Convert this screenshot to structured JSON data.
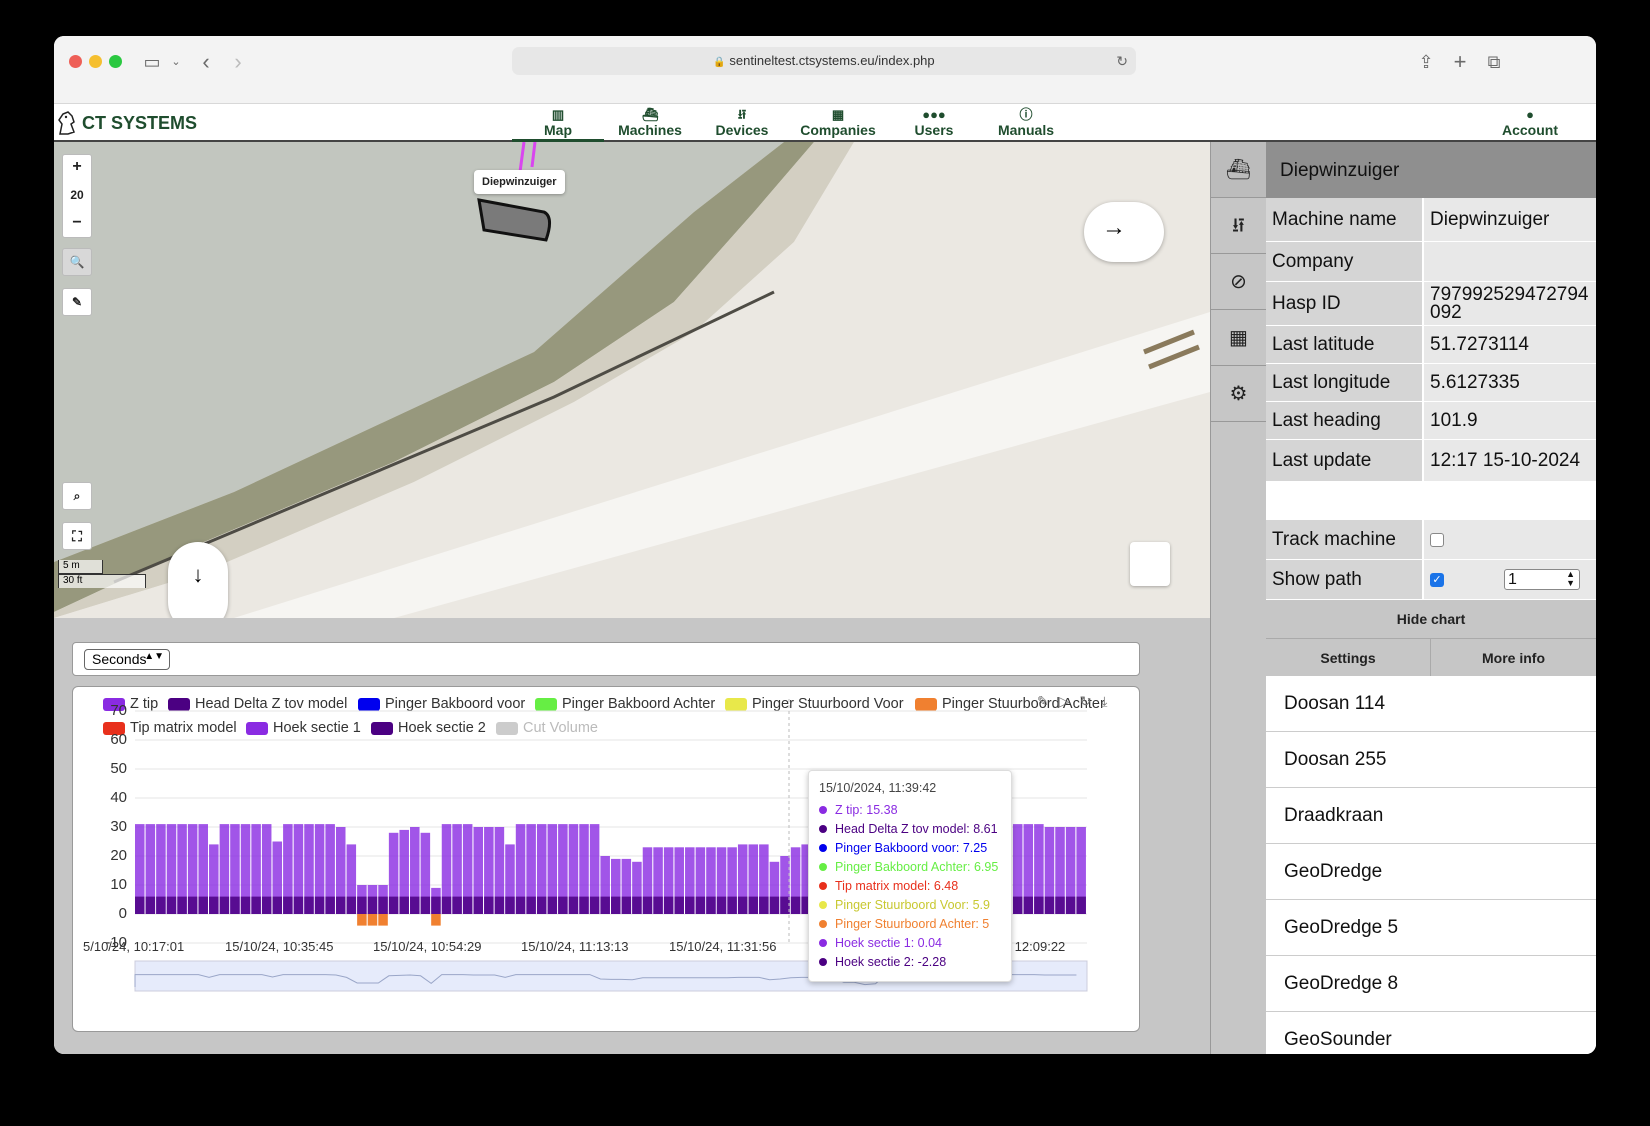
{
  "browser": {
    "url": "sentineltest.ctsystems.eu/index.php"
  },
  "app": {
    "brand": "CT SYSTEMS",
    "nav": [
      {
        "label": "Map",
        "icon": "map-icon",
        "active": true
      },
      {
        "label": "Machines",
        "icon": "ship-icon"
      },
      {
        "label": "Devices",
        "icon": "usb-icon"
      },
      {
        "label": "Companies",
        "icon": "building-icon"
      },
      {
        "label": "Users",
        "icon": "users-icon"
      },
      {
        "label": "Manuals",
        "icon": "info-icon"
      }
    ],
    "account": "Account"
  },
  "map": {
    "zoom_level": "20",
    "zoom_in": "+",
    "zoom_out": "−",
    "machine_label": "Diepwinzuiger",
    "scale_m": "5 m",
    "scale_ft": "30 ft"
  },
  "chart_controls": {
    "interval": "Seconds"
  },
  "panel": {
    "title": "Diepwinzuiger",
    "rows": [
      {
        "label": "Machine name",
        "value": "Diepwinzuiger"
      },
      {
        "label": "Company",
        "value": ""
      },
      {
        "label": "Hasp ID",
        "value": "797992529472794092"
      },
      {
        "label": "Last latitude",
        "value": "51.7273114"
      },
      {
        "label": "Last longitude",
        "value": "5.6127335"
      },
      {
        "label": "Last heading",
        "value": "101.9"
      },
      {
        "label": "Last update",
        "value": "12:17 15-10-2024"
      }
    ],
    "track_label": "Track machine",
    "track_checked": false,
    "path_label": "Show path",
    "path_checked": true,
    "path_value": "1",
    "hide_chart": "Hide chart",
    "settings": "Settings",
    "more_info": "More info",
    "machines": [
      "Doosan 114",
      "Doosan 255",
      "Draadkraan",
      "GeoDredge",
      "GeoDredge 5",
      "GeoDredge 8",
      "GeoSounder"
    ]
  },
  "chart_data": {
    "type": "bar",
    "ylim": [
      -10,
      70
    ],
    "yticks": [
      "70",
      "60",
      "50",
      "40",
      "30",
      "20",
      "10",
      "0",
      "-10"
    ],
    "xticks": [
      "5/10/24, 10:17:01",
      "15/10/24, 10:35:45",
      "15/10/24, 10:54:29",
      "15/10/24, 11:13:13",
      "15/10/24, 11:31:56",
      "24, 12:09:22"
    ],
    "legend": [
      {
        "name": "Z tip",
        "color": "#8a2be2"
      },
      {
        "name": "Head Delta Z tov model",
        "color": "#4b0082"
      },
      {
        "name": "Pinger Bakboord voor",
        "color": "#0000ee"
      },
      {
        "name": "Pinger Bakboord Achter",
        "color": "#66ee44"
      },
      {
        "name": "Pinger Stuurboord Voor",
        "color": "#e8e84a"
      },
      {
        "name": "Pinger Stuurboord Achter",
        "color": "#f08030"
      },
      {
        "name": "Tip matrix model",
        "color": "#e8301c"
      },
      {
        "name": "Hoek sectie 1",
        "color": "#8a2be2"
      },
      {
        "name": "Hoek sectie 2",
        "color": "#4b0082"
      },
      {
        "name": "Cut Volume",
        "color": "#cccccc",
        "disabled": true
      }
    ],
    "z_tip_profile": [
      31,
      31,
      31,
      31,
      31,
      31,
      31,
      24,
      31,
      31,
      31,
      31,
      31,
      25,
      31,
      31,
      31,
      31,
      31,
      30,
      24,
      10,
      10,
      10,
      28,
      29,
      30,
      28,
      9,
      31,
      31,
      31,
      30,
      30,
      30,
      24,
      31,
      31,
      31,
      31,
      31,
      31,
      31,
      31,
      20,
      19,
      19,
      18,
      23,
      23,
      23,
      23,
      23,
      23,
      23,
      23,
      23,
      24,
      24,
      24,
      18,
      20,
      23,
      24,
      24,
      24,
      24,
      12,
      12,
      6,
      8,
      31,
      31,
      31,
      31,
      31,
      31,
      31,
      31,
      31,
      31,
      31,
      31,
      31,
      31,
      31,
      30,
      30,
      30,
      30
    ],
    "tooltip": {
      "time": "15/10/2024, 11:39:42",
      "items": [
        {
          "label": "Z tip: 15.38",
          "color": "#8a2be2"
        },
        {
          "label": "Head Delta Z tov model: 8.61",
          "color": "#4b0082"
        },
        {
          "label": "Pinger Bakboord voor: 7.25",
          "color": "#0000ee"
        },
        {
          "label": "Pinger Bakboord Achter: 6.95",
          "color": "#66ee44"
        },
        {
          "label": "Tip matrix model: 6.48",
          "color": "#e8301c"
        },
        {
          "label": "Pinger Stuurboord Voor: 5.9",
          "color": "#e8e84a"
        },
        {
          "label": "Pinger Stuurboord Achter: 5",
          "color": "#f08030"
        },
        {
          "label": "Hoek sectie 1: 0.04",
          "color": "#8a2be2"
        },
        {
          "label": "Hoek sectie 2: -2.28",
          "color": "#4b0082"
        }
      ]
    }
  }
}
